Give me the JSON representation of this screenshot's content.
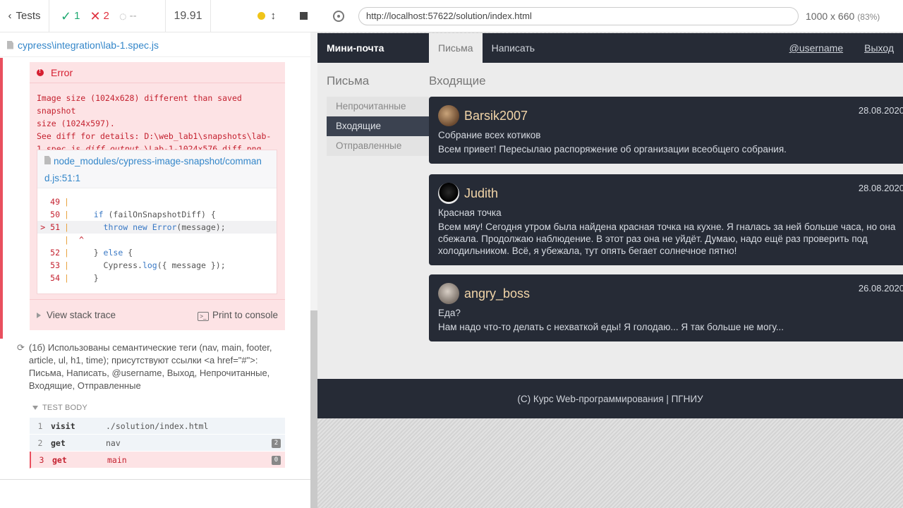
{
  "runner": {
    "back_label": "Tests",
    "passed": "1",
    "failed": "2",
    "pending": "--",
    "duration": "19.91",
    "spec_path": "cypress\\integration\\lab-1.spec.js",
    "error": {
      "title": "Error",
      "msg_line1": "Image size (1024x628) different than saved snapshot",
      "msg_line2": "size (1024x597).",
      "msg_line3a": "See diff for details: D:\\web_lab1\\snapshots\\lab-",
      "msg_line4a": "1.spec.js_",
      "msg_line4b": "diff_output",
      "msg_line4c": "_\\Lab-1-1024x576.diff.png",
      "code_file": "node_modules/cypress-image-snapshot/command.js:51:1",
      "code_lines": [
        {
          "n": "49",
          "marker": "",
          "text": ""
        },
        {
          "n": "50",
          "marker": "",
          "text": "    if (failOnSnapshotDiff) {"
        },
        {
          "n": "51",
          "marker": ">",
          "text": "      throw new Error(message);"
        },
        {
          "n": "",
          "marker": "",
          "text": "^"
        },
        {
          "n": "52",
          "marker": "",
          "text": "    } else {"
        },
        {
          "n": "53",
          "marker": "",
          "text": "      Cypress.log({ message });"
        },
        {
          "n": "54",
          "marker": "",
          "text": "    }"
        }
      ],
      "view_stack": "View stack trace",
      "print_console": "Print to console"
    },
    "test2_title": "(1б) Использованы семантические теги (nav, main, footer, article, ul, h1, time); присутствуют ссылки <a href=\"#\">: Письма, Написать, @username, Выход, Непрочитанные, Входящие, Отправленные",
    "test_body_label": "TEST BODY",
    "commands": [
      {
        "n": "1",
        "name": "visit",
        "arg": "./solution/index.html",
        "badge": ""
      },
      {
        "n": "2",
        "name": "get",
        "arg": "nav",
        "badge": "2"
      },
      {
        "n": "3",
        "name": "get",
        "arg": "main",
        "badge": "0"
      }
    ]
  },
  "aut": {
    "url": "http://localhost:57622/solution/index.html",
    "size": "1000 x 660",
    "scale": "(83%)"
  },
  "app": {
    "brand": "Мини-почта",
    "tabs": [
      "Письма",
      "Написать"
    ],
    "username": "@username",
    "logout": "Выход",
    "side_title": "Письма",
    "side_items": [
      "Непрочитанные",
      "Входящие",
      "Отправленные"
    ],
    "main_title": "Входящие",
    "letters": [
      {
        "author": "Barsik2007",
        "date": "28.08.2020",
        "subject": "Собрание всех котиков",
        "body": "Всем привет! Пересылаю распоряжение об организации всеобщего собрания.",
        "avatar_color": "#8a6a4a"
      },
      {
        "author": "Judith",
        "date": "28.08.2020",
        "subject": "Красная точка",
        "body": "Всем мяу! Сегодня утром была найдена красная точка на кухне. Я гналась за ней больше часа, но она сбежала. Продолжаю наблюдение. В этот раз она не уйдёт. Думаю, надо ещё раз проверить под холодильником. Всё, я убежала, тут опять бегает солнечное пятно!",
        "avatar_color": "#1a1a1a"
      },
      {
        "author": "angry_boss",
        "date": "26.08.2020",
        "subject": "Еда?",
        "body": "Нам надо что-то делать с нехваткой еды! Я голодаю... Я так больше не могу...",
        "avatar_color": "#9a8f86"
      }
    ],
    "footer": "(C) Курс Web-программирования | ПГНИУ"
  }
}
